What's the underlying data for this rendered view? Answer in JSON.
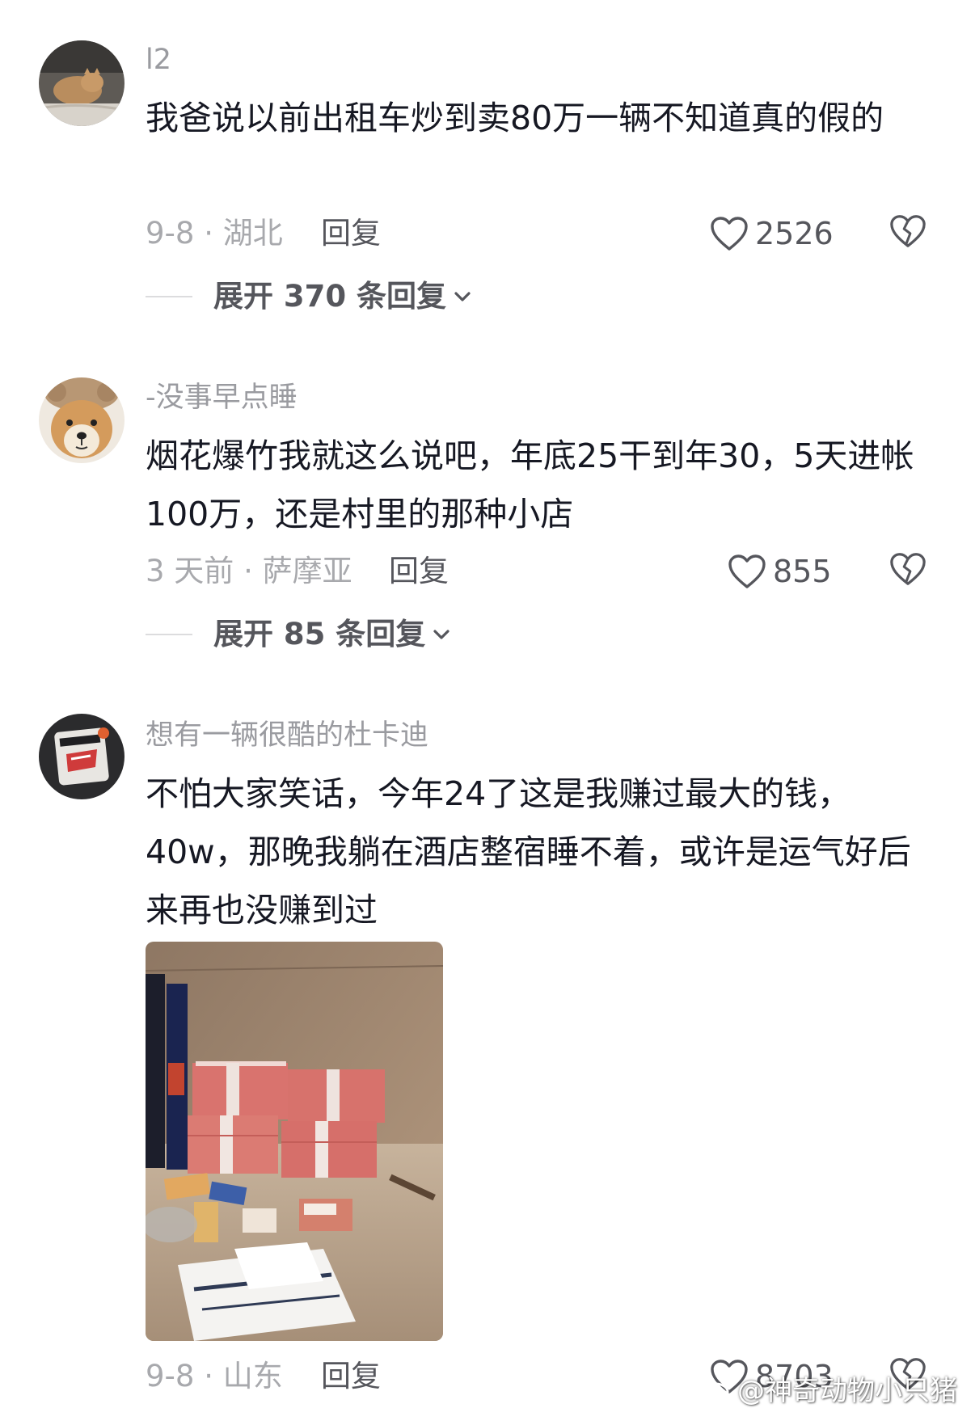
{
  "comments": [
    {
      "username": "l2",
      "text": "我爸说以前出租车炒到卖80万一辆不知道真的假的",
      "meta": "9-8 · 湖北",
      "reply_label": "回复",
      "likes": "2526",
      "expand_label": "展开 370 条回复",
      "avatar_icon": "cat-photo-avatar"
    },
    {
      "username": "-没事早点睡",
      "text": "烟花爆竹我就这么说吧，年底25干到年30，5天进帐100万，还是村里的那种小店",
      "meta": "3 天前 · 萨摩亚",
      "reply_label": "回复",
      "likes": "855",
      "expand_label": "展开 85 条回复",
      "avatar_icon": "shiba-dog-avatar"
    },
    {
      "username": "想有一辆很酷的杜卡迪",
      "text": "不怕大家笑话，今年24了这是我赚过最大的钱，40w，那晚我躺在酒店整宿睡不着，或许是运气好后来再也没赚到过",
      "meta": "9-8 · 山东",
      "reply_label": "回复",
      "likes": "8703",
      "avatar_icon": "dark-sticker-avatar",
      "image_subject": "stacks-of-cash-photo"
    }
  ],
  "watermark": "@神奇动物小只猪",
  "colors": {
    "username": "#9a9ba0",
    "text": "#161823",
    "meta": "#a8a9ad",
    "action": "#55565c",
    "cash": "#d9736e"
  }
}
